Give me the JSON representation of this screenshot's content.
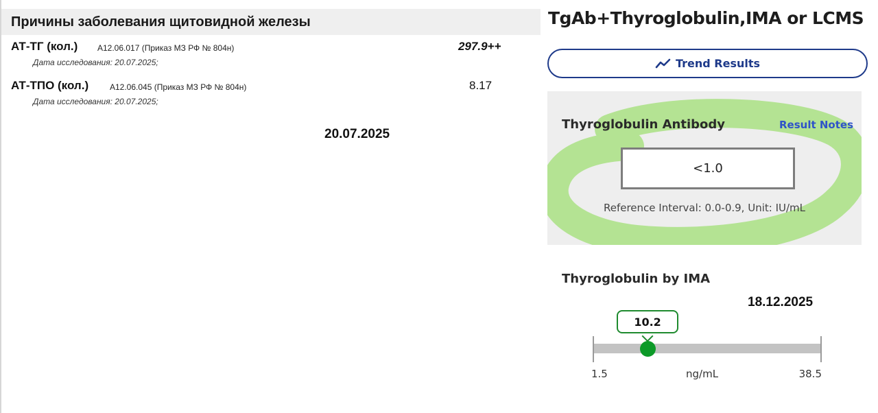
{
  "left": {
    "section_title": "Причины заболевания щитовидной железы",
    "tests": [
      {
        "name": "АТ-ТГ (кол.)",
        "code": "A12.06.017 (Приказ МЗ РФ № 804н)",
        "value": "297.9++",
        "date_label": "Дата исследования: 20.07.2025;"
      },
      {
        "name": "АТ-ТПО (кол.)",
        "code": "A12.06.045 (Приказ МЗ РФ № 804н)",
        "value": "8.17",
        "date_label": "Дата исследования: 20.07.2025;"
      }
    ],
    "date_caption": "20.07.2025"
  },
  "right": {
    "title": "TgAb+Thyroglobulin,IMA or LCMS",
    "trend_button": {
      "label": "Trend Results",
      "icon": "trend-line-icon",
      "color": "#1e3a8a"
    },
    "antibody": {
      "title": "Thyroglobulin Antibody",
      "notes_link": "Result Notes",
      "value": "<1.0",
      "reference": "Reference Interval: 0.0-0.9, Unit: IU/mL",
      "highlight_color": "#8fdc5a"
    },
    "ima": {
      "title": "Thyroglobulin by IMA",
      "date_caption": "18.12.2025",
      "value_label": "10.2",
      "value": 10.2,
      "range_min": 1.5,
      "range_max": 38.5,
      "min_label": "1.5",
      "max_label": "38.5",
      "unit": "ng/mL",
      "marker_color": "#0c9a28"
    }
  }
}
